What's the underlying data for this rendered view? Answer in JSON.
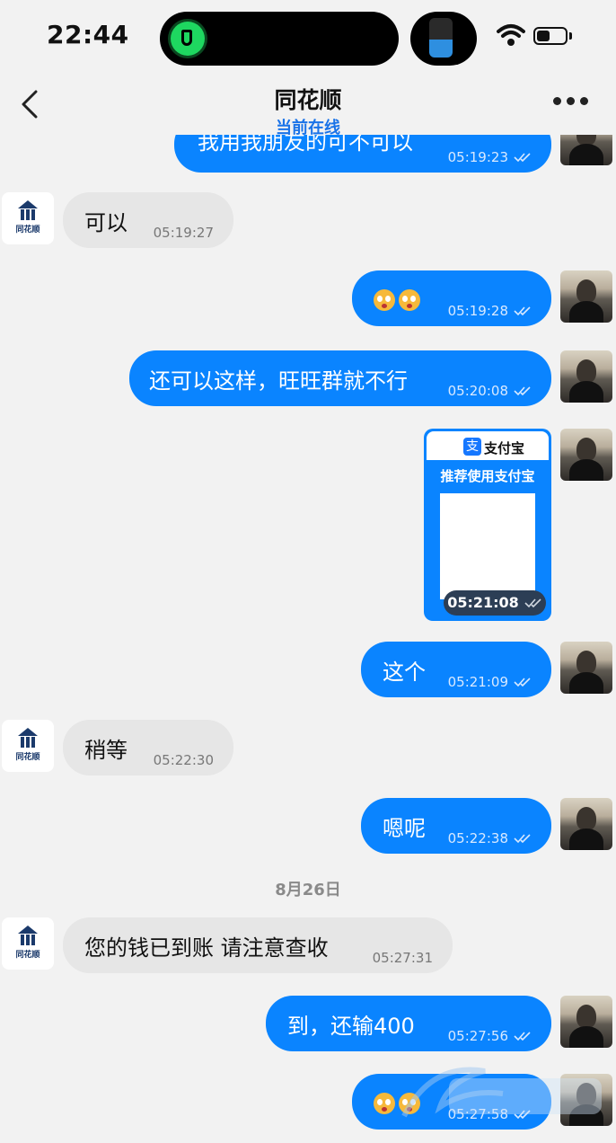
{
  "status_bar": {
    "time": "22:44"
  },
  "header": {
    "title": "同花顺",
    "subtitle": "当前在线"
  },
  "messages": [
    {
      "id": "m1",
      "from": "me",
      "text": "我用我朋友的可不可以",
      "time": "05:19:23"
    },
    {
      "id": "m2",
      "from": "shop",
      "text": "可以",
      "time": "05:19:27"
    },
    {
      "id": "m3",
      "from": "me",
      "text": "",
      "emoji": [
        "flushed-face",
        "flushed-face"
      ],
      "time": "05:19:28"
    },
    {
      "id": "m4",
      "from": "me",
      "text": "还可以这样，旺旺群就不行",
      "time": "05:20:08"
    },
    {
      "id": "m5",
      "from": "me",
      "type": "card",
      "card": {
        "brand": "支付宝",
        "recommend": "推荐使用支付宝"
      },
      "time": "05:21:08"
    },
    {
      "id": "m6",
      "from": "me",
      "text": "这个",
      "time": "05:21:09"
    },
    {
      "id": "m7",
      "from": "shop",
      "text": "稍等",
      "time": "05:22:30"
    },
    {
      "id": "m8",
      "from": "me",
      "text": "嗯呢",
      "time": "05:22:38"
    },
    {
      "id": "m9",
      "from": "shop",
      "text": "您的钱已到账  请注意查收",
      "time": "05:27:31"
    },
    {
      "id": "m10",
      "from": "me",
      "text": "到，还输400",
      "time": "05:27:56"
    },
    {
      "id": "m11",
      "from": "me",
      "text": "",
      "emoji": [
        "crying-face",
        "crying-face"
      ],
      "time": "05:27:58"
    }
  ],
  "date_separator": "8月26日",
  "shop_logo_text": "同花顺",
  "colors": {
    "outgoing_bubble": "#0a84ff",
    "incoming_bubble": "#e6e6e6",
    "accent": "#1a73e8"
  }
}
